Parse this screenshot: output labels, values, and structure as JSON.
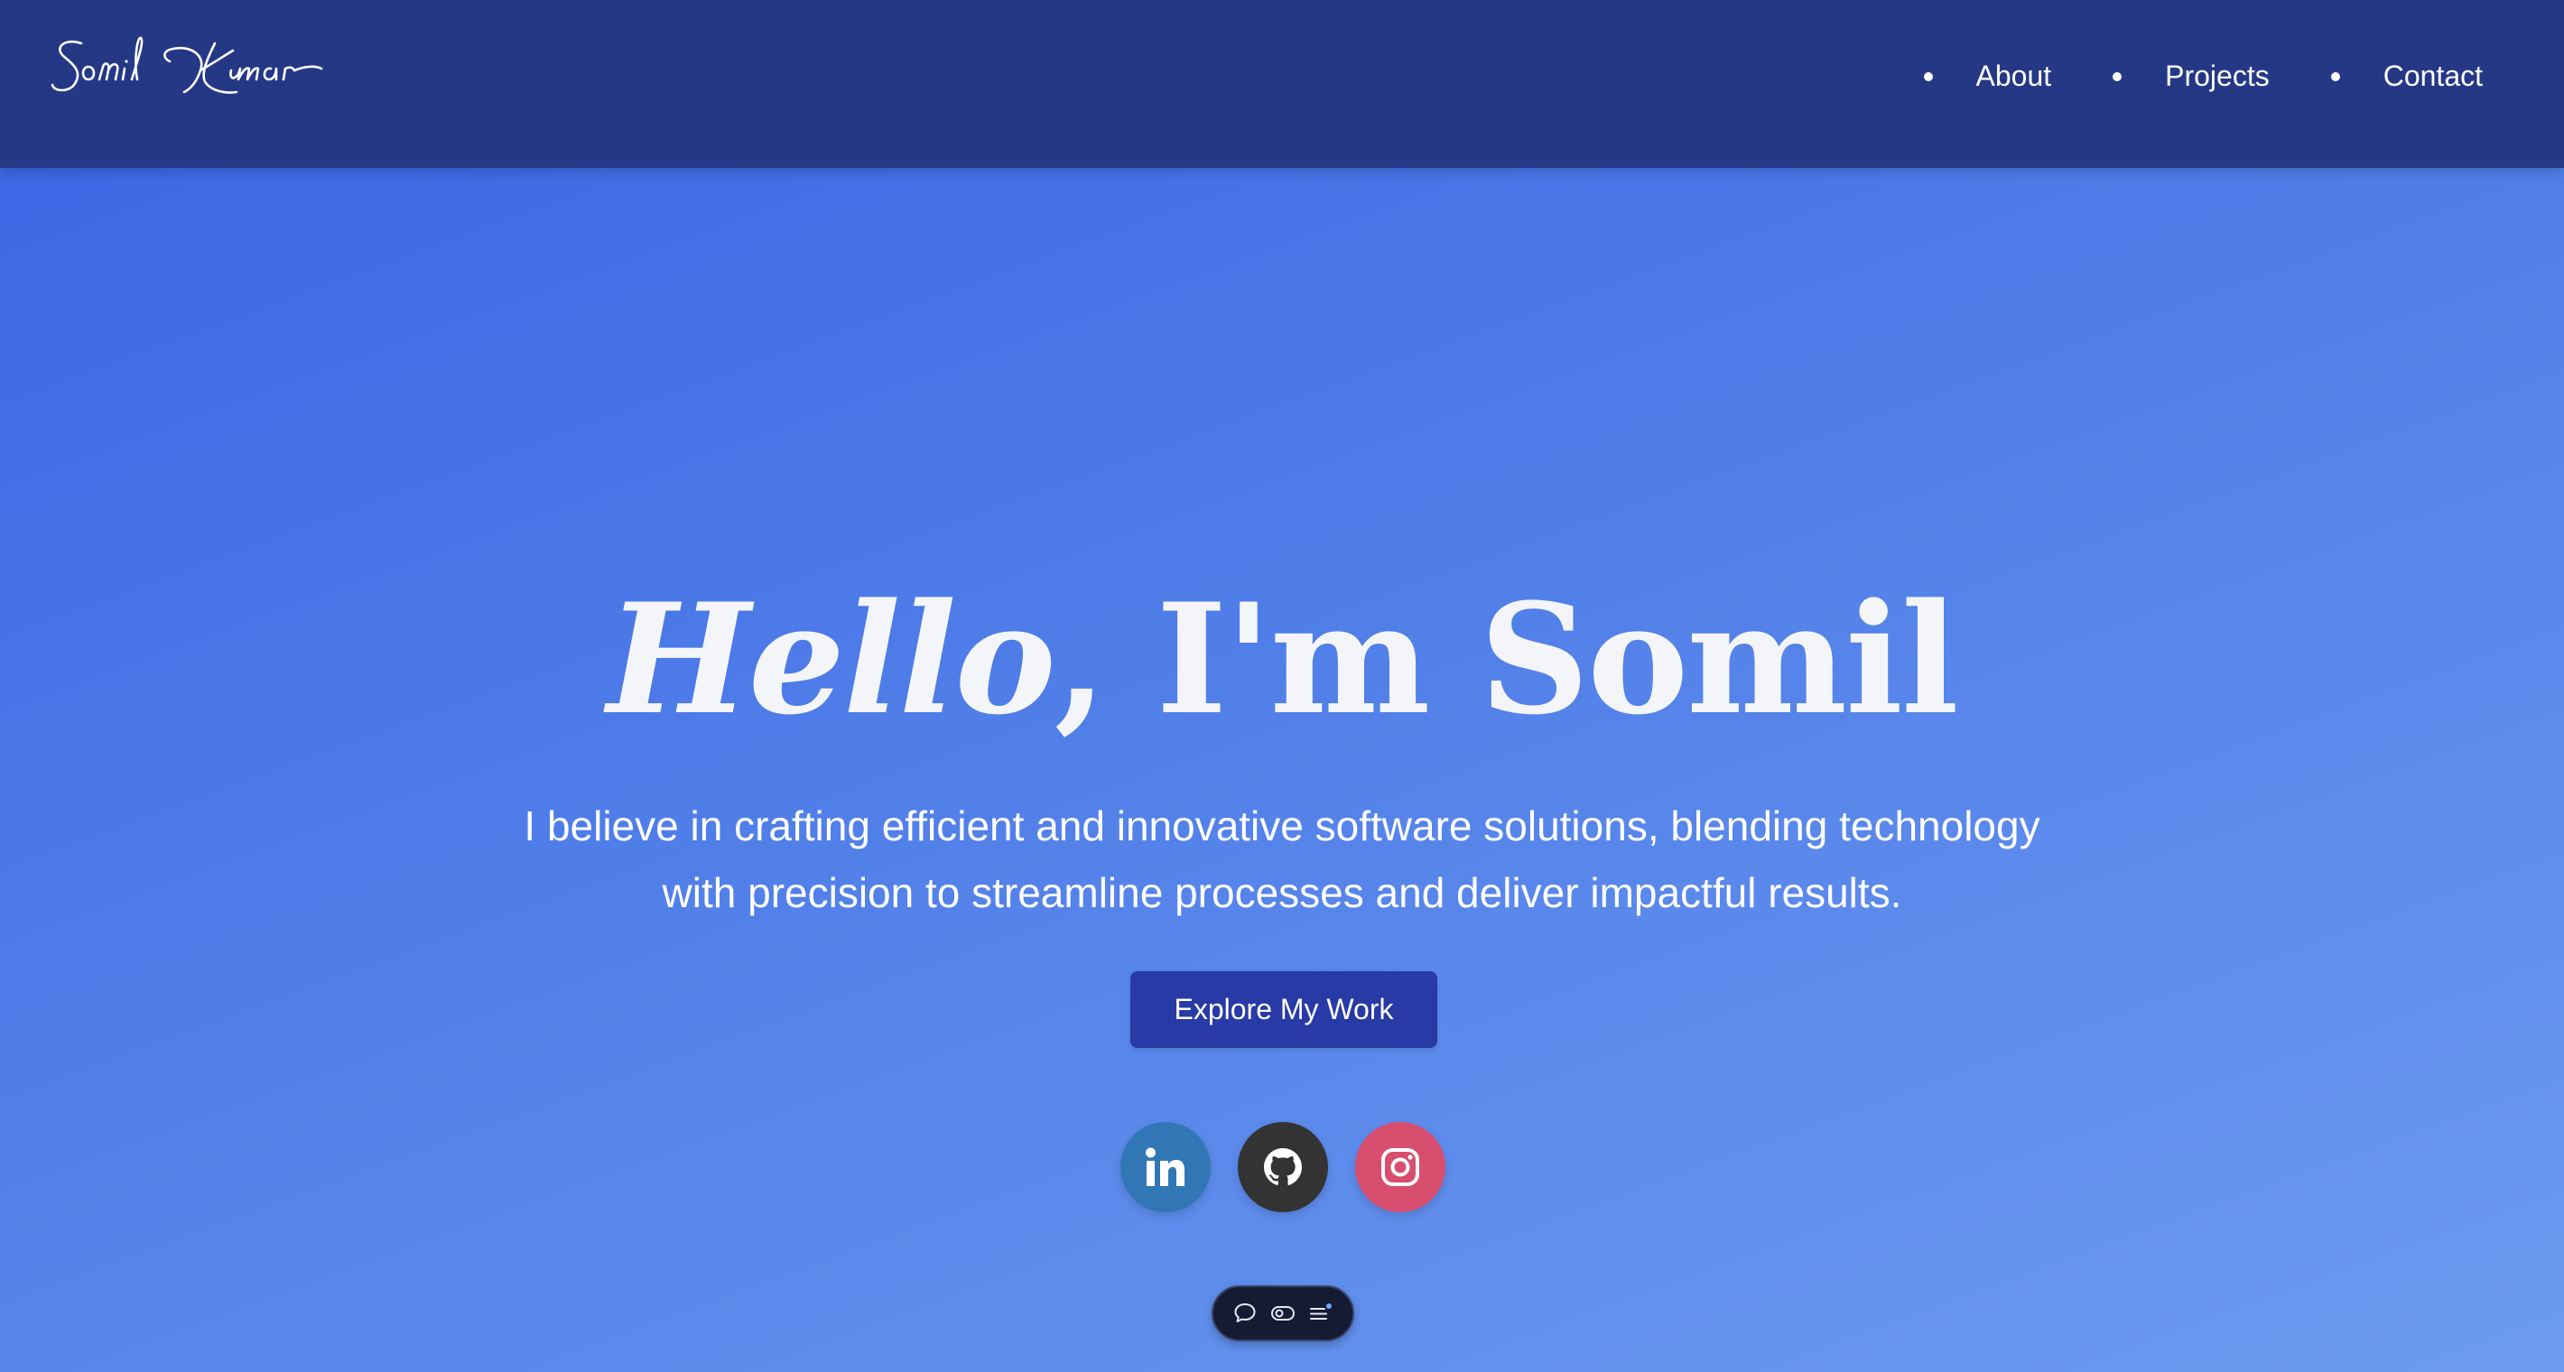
{
  "brand": {
    "signature_text": "Somil Kumar"
  },
  "nav": {
    "items": [
      {
        "label": "About"
      },
      {
        "label": "Projects"
      },
      {
        "label": "Contact"
      }
    ]
  },
  "hero": {
    "greeting": "Hello",
    "comma": ",",
    "name_line": " I'm Somil",
    "subtitle_line1": "I believe in crafting efficient and innovative software solutions, blending technology",
    "subtitle_line2": "with precision to streamline processes and deliver impactful results.",
    "cta_label": "Explore My Work"
  },
  "social": [
    {
      "name": "linkedin-icon",
      "color": "#3277b5"
    },
    {
      "name": "github-icon",
      "color": "#333333"
    },
    {
      "name": "instagram-icon",
      "color": "#d84e6e"
    }
  ],
  "toolbar": {
    "icons": [
      "chat-bubble-icon",
      "toggle-icon",
      "menu-list-icon"
    ]
  },
  "colors": {
    "navbar_bg": "#253886",
    "hero_gradient_start": "#3a62e4",
    "hero_gradient_end": "#6c9bf0",
    "cta_bg": "#283aa6"
  }
}
